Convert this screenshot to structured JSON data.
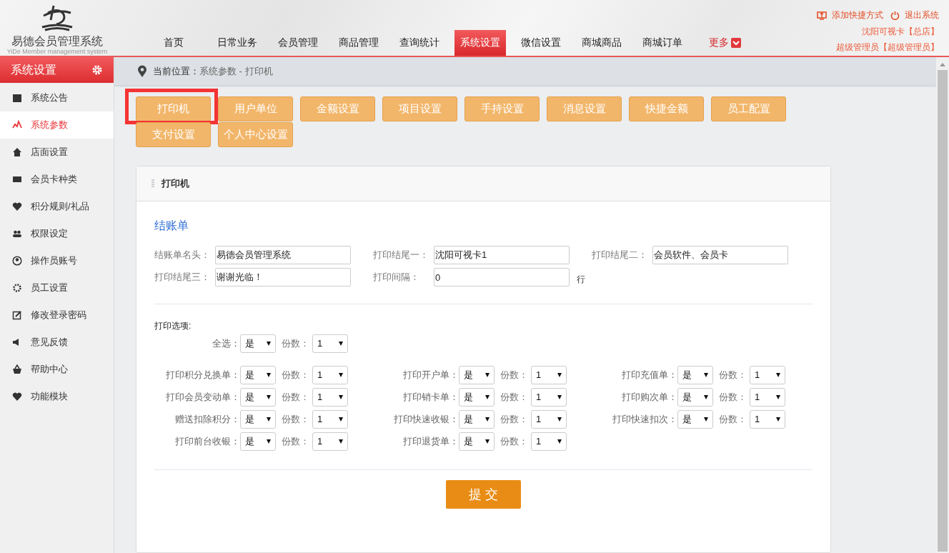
{
  "logo": {
    "title": "易德会员管理系统",
    "subtitle": "YiDe Member management system"
  },
  "nav": [
    {
      "label": "首页",
      "selected": false
    },
    {
      "label": "日常业务",
      "selected": false
    },
    {
      "label": "会员管理",
      "selected": false
    },
    {
      "label": "商品管理",
      "selected": false
    },
    {
      "label": "查询统计",
      "selected": false
    },
    {
      "label": "系统设置",
      "selected": true
    },
    {
      "label": "微信设置",
      "selected": false
    },
    {
      "label": "商城商品",
      "selected": false
    },
    {
      "label": "商城订单",
      "selected": false
    }
  ],
  "more": {
    "label": "更多"
  },
  "top_links": [
    {
      "label": "添加快捷方式"
    },
    {
      "label": "退出系统"
    }
  ],
  "user": {
    "store": "沈阳可视卡【总店】",
    "role": "超级管理员【超级管理员】"
  },
  "sidebar": {
    "title": "系统设置",
    "items": [
      {
        "label": "系统公告",
        "selected": false
      },
      {
        "label": "系统参数",
        "selected": true
      },
      {
        "label": "店面设置",
        "selected": false
      },
      {
        "label": "会员卡种类",
        "selected": false
      },
      {
        "label": "积分规则/礼品",
        "selected": false
      },
      {
        "label": "权限设定",
        "selected": false
      },
      {
        "label": "操作员账号",
        "selected": false
      },
      {
        "label": "员工设置",
        "selected": false
      },
      {
        "label": "修改登录密码",
        "selected": false
      },
      {
        "label": "意见反馈",
        "selected": false
      },
      {
        "label": "帮助中心",
        "selected": false
      },
      {
        "label": "功能模块",
        "selected": false
      }
    ]
  },
  "breadcrumb": {
    "label": "当前位置：",
    "path": "系统参数 - 打印机"
  },
  "tabs": [
    {
      "label": "打印机",
      "highlighted": true
    },
    {
      "label": "用户单位",
      "highlighted": false
    },
    {
      "label": "金额设置",
      "highlighted": false
    },
    {
      "label": "项目设置",
      "highlighted": false
    },
    {
      "label": "手持设置",
      "highlighted": false
    },
    {
      "label": "消息设置",
      "highlighted": false
    },
    {
      "label": "快捷金额",
      "highlighted": false
    },
    {
      "label": "员工配置",
      "highlighted": false
    },
    {
      "label": "支付设置",
      "highlighted": false
    },
    {
      "label": "个人中心设置",
      "highlighted": false
    }
  ],
  "panel": {
    "title": "打印机",
    "section": "结账单",
    "fields": [
      {
        "label": "结账单名头：",
        "value": "易德会员管理系统"
      },
      {
        "label": "打印结尾一：",
        "value": "沈阳可视卡1"
      },
      {
        "label": "打印结尾二：",
        "value": "会员软件、会员卡"
      },
      {
        "label": "打印结尾三：",
        "value": "谢谢光临！"
      },
      {
        "label": "打印间隔：",
        "value": "0",
        "unit": "行"
      }
    ],
    "options_title": "打印选项:",
    "select_all": {
      "label": "全选：",
      "value": "是",
      "copies_label": "份数：",
      "copies": "1"
    },
    "option_columns": [
      [
        {
          "label": "打印积分兑换单：",
          "value": "是",
          "copies_label": "份数：",
          "copies": "1"
        },
        {
          "label": "打印会员变动单：",
          "value": "是",
          "copies_label": "份数：",
          "copies": "1"
        },
        {
          "label": "赠送扣除积分：",
          "value": "是",
          "copies_label": "份数：",
          "copies": "1"
        },
        {
          "label": "打印前台收银：",
          "value": "是",
          "copies_label": "份数：",
          "copies": "1"
        }
      ],
      [
        {
          "label": "打印开户单：",
          "value": "是",
          "copies_label": "份数：",
          "copies": "1"
        },
        {
          "label": "打印销卡单：",
          "value": "是",
          "copies_label": "份数：",
          "copies": "1"
        },
        {
          "label": "打印快速收银：",
          "value": "是",
          "copies_label": "份数：",
          "copies": "1"
        },
        {
          "label": "打印退货单：",
          "value": "是",
          "copies_label": "份数：",
          "copies": "1"
        }
      ],
      [
        {
          "label": "打印充值单：",
          "value": "是",
          "copies_label": "份数：",
          "copies": "1"
        },
        {
          "label": "打印购次单：",
          "value": "是",
          "copies_label": "份数：",
          "copies": "1"
        },
        {
          "label": "打印快速扣次：",
          "value": "是",
          "copies_label": "份数：",
          "copies": "1"
        }
      ]
    ],
    "submit": "提 交"
  }
}
